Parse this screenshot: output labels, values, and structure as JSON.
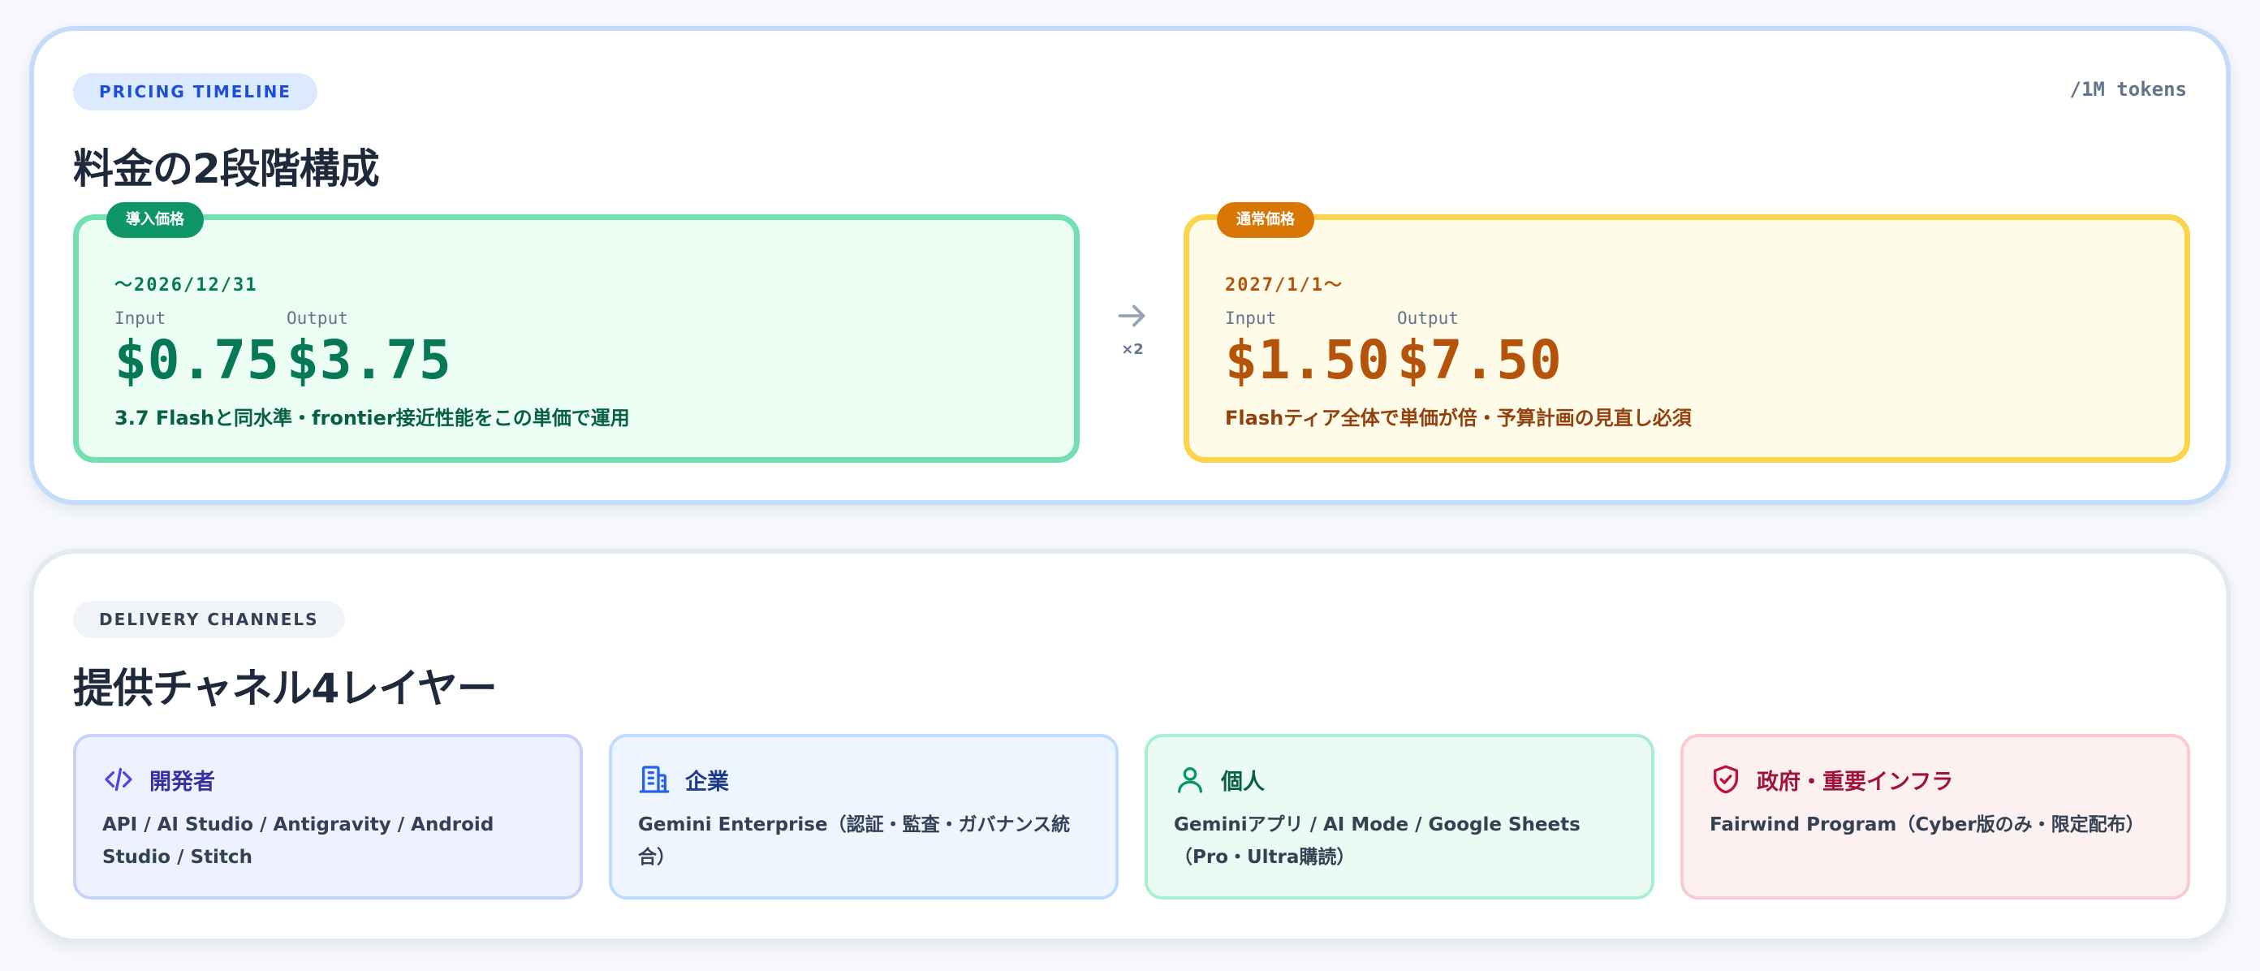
{
  "pricing": {
    "eyebrow": "PRICING TIMELINE",
    "units": "/1M tokens",
    "title": "料金の2段階構成",
    "multiplier": "×2",
    "intro": {
      "tag": "導入価格",
      "date": "〜2026/12/31",
      "input_label": "Input",
      "input_price": "$0.75",
      "output_label": "Output",
      "output_price": "$3.75",
      "note": "3.7 Flashと同水準・frontier接近性能をこの単価で運用"
    },
    "regular": {
      "tag": "通常価格",
      "date": "2027/1/1〜",
      "input_label": "Input",
      "input_price": "$1.50",
      "output_label": "Output",
      "output_price": "$7.50",
      "note": "Flashティア全体で単価が倍・予算計画の見直し必須"
    }
  },
  "channels": {
    "eyebrow": "DELIVERY CHANNELS",
    "title": "提供チャネル4レイヤー",
    "items": [
      {
        "name": "開発者",
        "icon": "code-icon",
        "description": "API / AI Studio / Antigravity / Android Studio / Stitch",
        "accent": "#4f46e5"
      },
      {
        "name": "企業",
        "icon": "building-icon",
        "description": "Gemini Enterprise（認証・監査・ガバナンス統合）",
        "accent": "#2563eb"
      },
      {
        "name": "個人",
        "icon": "user-icon",
        "description": "Geminiアプリ / AI Mode / Google Sheets（Pro・Ultra購読）",
        "accent": "#059669"
      },
      {
        "name": "政府・重要インフラ",
        "icon": "shield-check-icon",
        "description": "Fairwind Program（Cyber版のみ・限定配布）",
        "accent": "#be123c"
      }
    ]
  },
  "colors": {
    "intro_accent": "#0f9668",
    "regular_accent": "#d97706",
    "pricing_border": "#c4dcf8"
  }
}
